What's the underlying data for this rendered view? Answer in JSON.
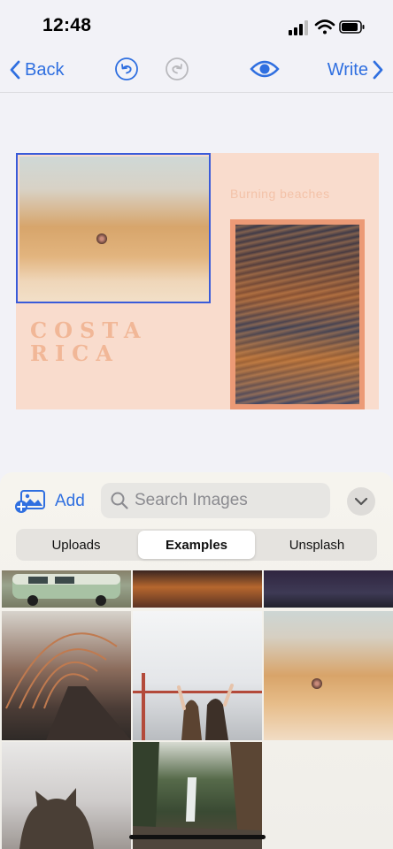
{
  "status_bar": {
    "time": "12:48"
  },
  "nav": {
    "back_label": "Back",
    "write_label": "Write"
  },
  "design": {
    "title_line1": "COSTA",
    "title_line2": "RICA",
    "subtitle": "Burning beaches"
  },
  "image_panel": {
    "add_label": "Add",
    "search_placeholder": "Search Images",
    "tabs": [
      {
        "label": "Uploads",
        "active": false
      },
      {
        "label": "Examples",
        "active": true
      },
      {
        "label": "Unsplash",
        "active": false
      }
    ]
  },
  "colors": {
    "accent": "#2f6fe0",
    "selection": "#3a5bd9",
    "card_background": "#f9dccd",
    "title_text": "#f1b797",
    "photo_frame": "#ec9a76"
  }
}
